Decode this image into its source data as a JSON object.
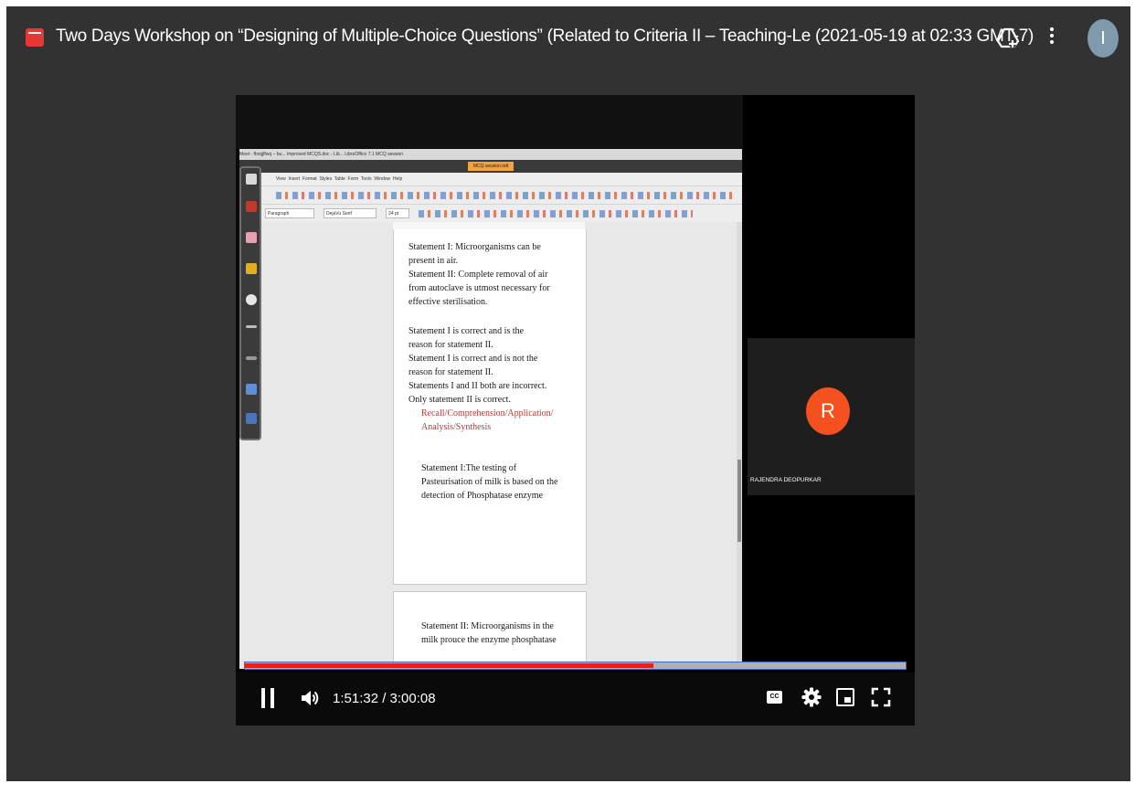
{
  "window": {
    "title": "Two Days Workshop on “Designing of Multiple-Choice Questions” (Related to Criteria II – Teaching-Le (2021-05-19 at 02:33 GMT-7)",
    "avatar_letter": "I"
  },
  "shared_screen": {
    "taskbar_text": "Meet - fbrsjjffwq – bu...   Improved MCQS.doc - Lib...   LibreOffice 7.1   MCQ session",
    "office_title": "MCQ session.odt",
    "menu": [
      "View",
      "Insert",
      "Format",
      "Styles",
      "Table",
      "Form",
      "Tools",
      "Window",
      "Help"
    ],
    "paragraph_style": "Paragraph",
    "font_name": "DejaVu Serif",
    "font_size": "24 pt",
    "document": {
      "lines": [
        "Statement I: Microorganisms can be",
        "present in air.",
        "Statement  II: Complete removal of air",
        "from autoclave is utmost necessary for",
        "effective sterilisation.",
        "Statement  I is  correct and is the",
        "reason  for  statement II.",
        "Statement I is correct and is not the",
        "reason  for  statement II.",
        "Statements I and II both are incorrect.",
        "Only statement II is correct."
      ],
      "taxonomy_lines": [
        "Recall/Comprehension/Application/",
        "Analysis/Synthesis"
      ],
      "lines2": [
        "Statement I:The testing  of",
        "Pasteurisation of milk is based on the",
        "detection of Phosphatase enzyme"
      ],
      "lines3": [
        "Statement II: Microorganisms in the",
        "milk prouce the enzyme phosphatase"
      ]
    }
  },
  "participant": {
    "initial": "R",
    "name": "RAJENDRA DEOPURKAR",
    "avatar_color": "#f4511e"
  },
  "player": {
    "progress_fraction": 0.62,
    "time": "1:51:32 / 3:00:08",
    "cc_label": "CC",
    "progress_color": "#e62117"
  }
}
